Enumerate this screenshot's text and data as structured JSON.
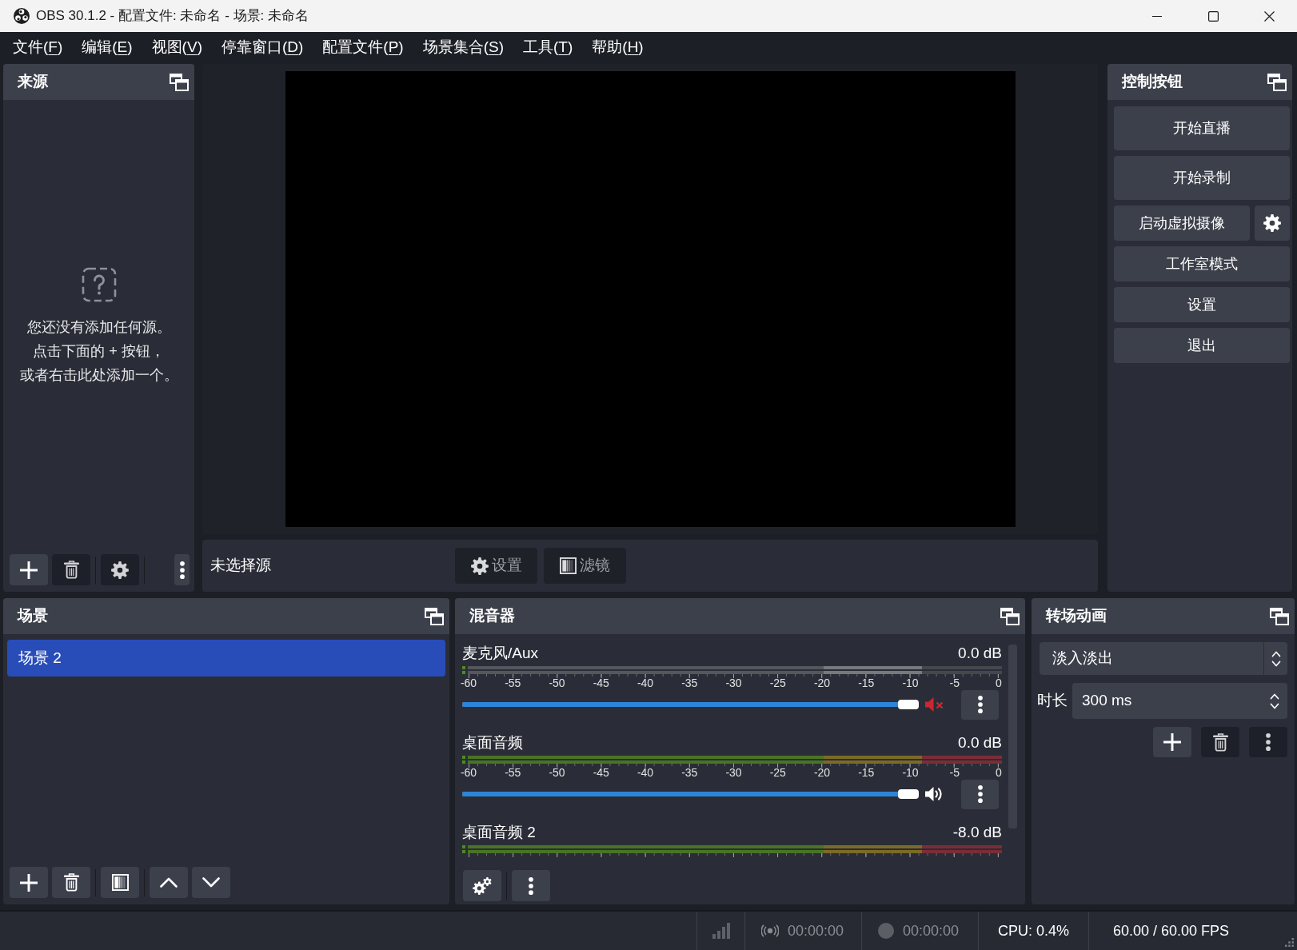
{
  "window": {
    "title": "OBS 30.1.2 - 配置文件: 未命名 - 场景: 未命名"
  },
  "menu": [
    {
      "before": "文件(",
      "accel": "F",
      "after": ")"
    },
    {
      "before": "编辑(",
      "accel": "E",
      "after": ")"
    },
    {
      "before": "视图(",
      "accel": "V",
      "after": ")"
    },
    {
      "before": "停靠窗口(",
      "accel": "D",
      "after": ")"
    },
    {
      "before": "配置文件(",
      "accel": "P",
      "after": ")"
    },
    {
      "before": "场景集合(",
      "accel": "S",
      "after": ")"
    },
    {
      "before": "工具(",
      "accel": "T",
      "after": ")"
    },
    {
      "before": "帮助(",
      "accel": "H",
      "after": ")"
    }
  ],
  "sources": {
    "title": "来源",
    "empty_message": [
      "您还没有添加任何源。",
      "点击下面的 + 按钮，",
      "或者右击此处添加一个。"
    ],
    "toolbar": [
      {
        "kind": "add",
        "disabled": false
      },
      {
        "kind": "remove",
        "disabled": true
      },
      {
        "kind": "separator"
      },
      {
        "kind": "properties",
        "disabled": true
      },
      {
        "kind": "separator"
      },
      {
        "kind": "overflow",
        "disabled": false
      }
    ]
  },
  "context_bar": {
    "label": "未选择源",
    "buttons": [
      {
        "kind": "properties",
        "label": "设置",
        "disabled": true
      },
      {
        "kind": "filters",
        "label": "滤镜",
        "disabled": true
      }
    ]
  },
  "controls": {
    "title": "控制按钮",
    "buttons": [
      {
        "kind": "tall",
        "label": "开始直播"
      },
      {
        "kind": "tall",
        "label": "开始录制"
      },
      {
        "kind": "split",
        "label": "启动虚拟摄像"
      },
      {
        "kind": "regular",
        "label": "工作室模式"
      },
      {
        "kind": "regular",
        "label": "设置"
      },
      {
        "kind": "regular",
        "label": "退出"
      }
    ]
  },
  "scenes": {
    "title": "场景",
    "items": [
      {
        "label": "场景 2",
        "selected": true
      }
    ],
    "toolbar": [
      {
        "kind": "add",
        "disabled": false
      },
      {
        "kind": "remove",
        "disabled": false
      },
      {
        "kind": "separator"
      },
      {
        "kind": "filters",
        "disabled": false
      },
      {
        "kind": "separator"
      },
      {
        "kind": "up",
        "disabled": false
      },
      {
        "kind": "down",
        "disabled": false
      }
    ]
  },
  "mixer": {
    "title": "混音器",
    "channels": [
      {
        "name": "麦克风/Aux",
        "reading": "0.0 dB",
        "muted": true,
        "level": 1,
        "scale": [
          "-60",
          "-55",
          "-50",
          "-45",
          "-40",
          "-35",
          "-30",
          "-25",
          "-20",
          "-15",
          "-10",
          "-5",
          "0"
        ]
      },
      {
        "name": "桌面音频",
        "reading": "0.0 dB",
        "muted": false,
        "level": 1,
        "scale": [
          "-60",
          "-55",
          "-50",
          "-45",
          "-40",
          "-35",
          "-30",
          "-25",
          "-20",
          "-15",
          "-10",
          "-5",
          "0"
        ]
      },
      {
        "name": "桌面音频 2",
        "reading": "-8.0 dB",
        "muted": false
      }
    ],
    "toolbar": [
      {
        "kind": "advanced",
        "disabled": false
      },
      {
        "kind": "separator"
      },
      {
        "kind": "more",
        "disabled": false
      }
    ]
  },
  "transitions": {
    "title": "转场动画",
    "transition": "淡入淡出",
    "duration_label": "时长",
    "duration": "300 ms",
    "toolbar": [
      {
        "kind": "add",
        "disabled": false
      },
      {
        "kind": "remove",
        "disabled": true
      },
      {
        "kind": "more",
        "disabled": true
      }
    ]
  },
  "status_bar": {
    "streaming": false,
    "stream_time": "00:00:00",
    "recording": false,
    "record_time": "00:00:00",
    "cpu": "CPU: 0.4%",
    "fps": "60.00 / 60.00 FPS"
  }
}
